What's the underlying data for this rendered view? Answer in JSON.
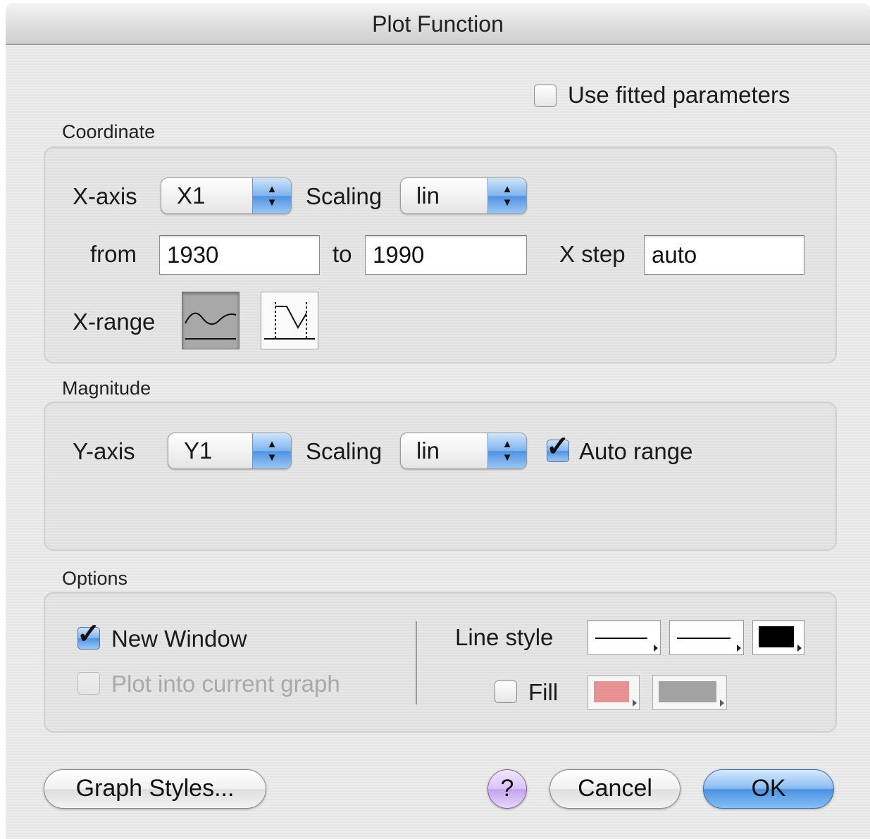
{
  "dialog": {
    "title": "Plot Function"
  },
  "use_fitted": {
    "label": "Use fitted parameters",
    "checked": false
  },
  "coordinate": {
    "section_label": "Coordinate",
    "xaxis_label": "X-axis",
    "xaxis_value": "X1",
    "scaling_label": "Scaling",
    "scaling_value": "lin",
    "from_label": "from",
    "from_value": "1930",
    "to_label": "to",
    "to_value": "1990",
    "xstep_label": "X step",
    "xstep_value": "auto",
    "xrange_label": "X-range"
  },
  "magnitude": {
    "section_label": "Magnitude",
    "yaxis_label": "Y-axis",
    "yaxis_value": "Y1",
    "scaling_label": "Scaling",
    "scaling_value": "lin",
    "auto_range_label": "Auto range",
    "auto_range_checked": true
  },
  "options": {
    "section_label": "Options",
    "new_window_label": "New Window",
    "new_window_checked": true,
    "plot_into_label": "Plot into current graph",
    "plot_into_checked": false,
    "line_style_label": "Line style",
    "fill_label": "Fill",
    "fill_checked": false,
    "line_color": "#000000",
    "fill_color_1": "#e87070",
    "fill_color_2": "#888888"
  },
  "buttons": {
    "graph_styles": "Graph Styles...",
    "help": "?",
    "cancel": "Cancel",
    "ok": "OK"
  }
}
